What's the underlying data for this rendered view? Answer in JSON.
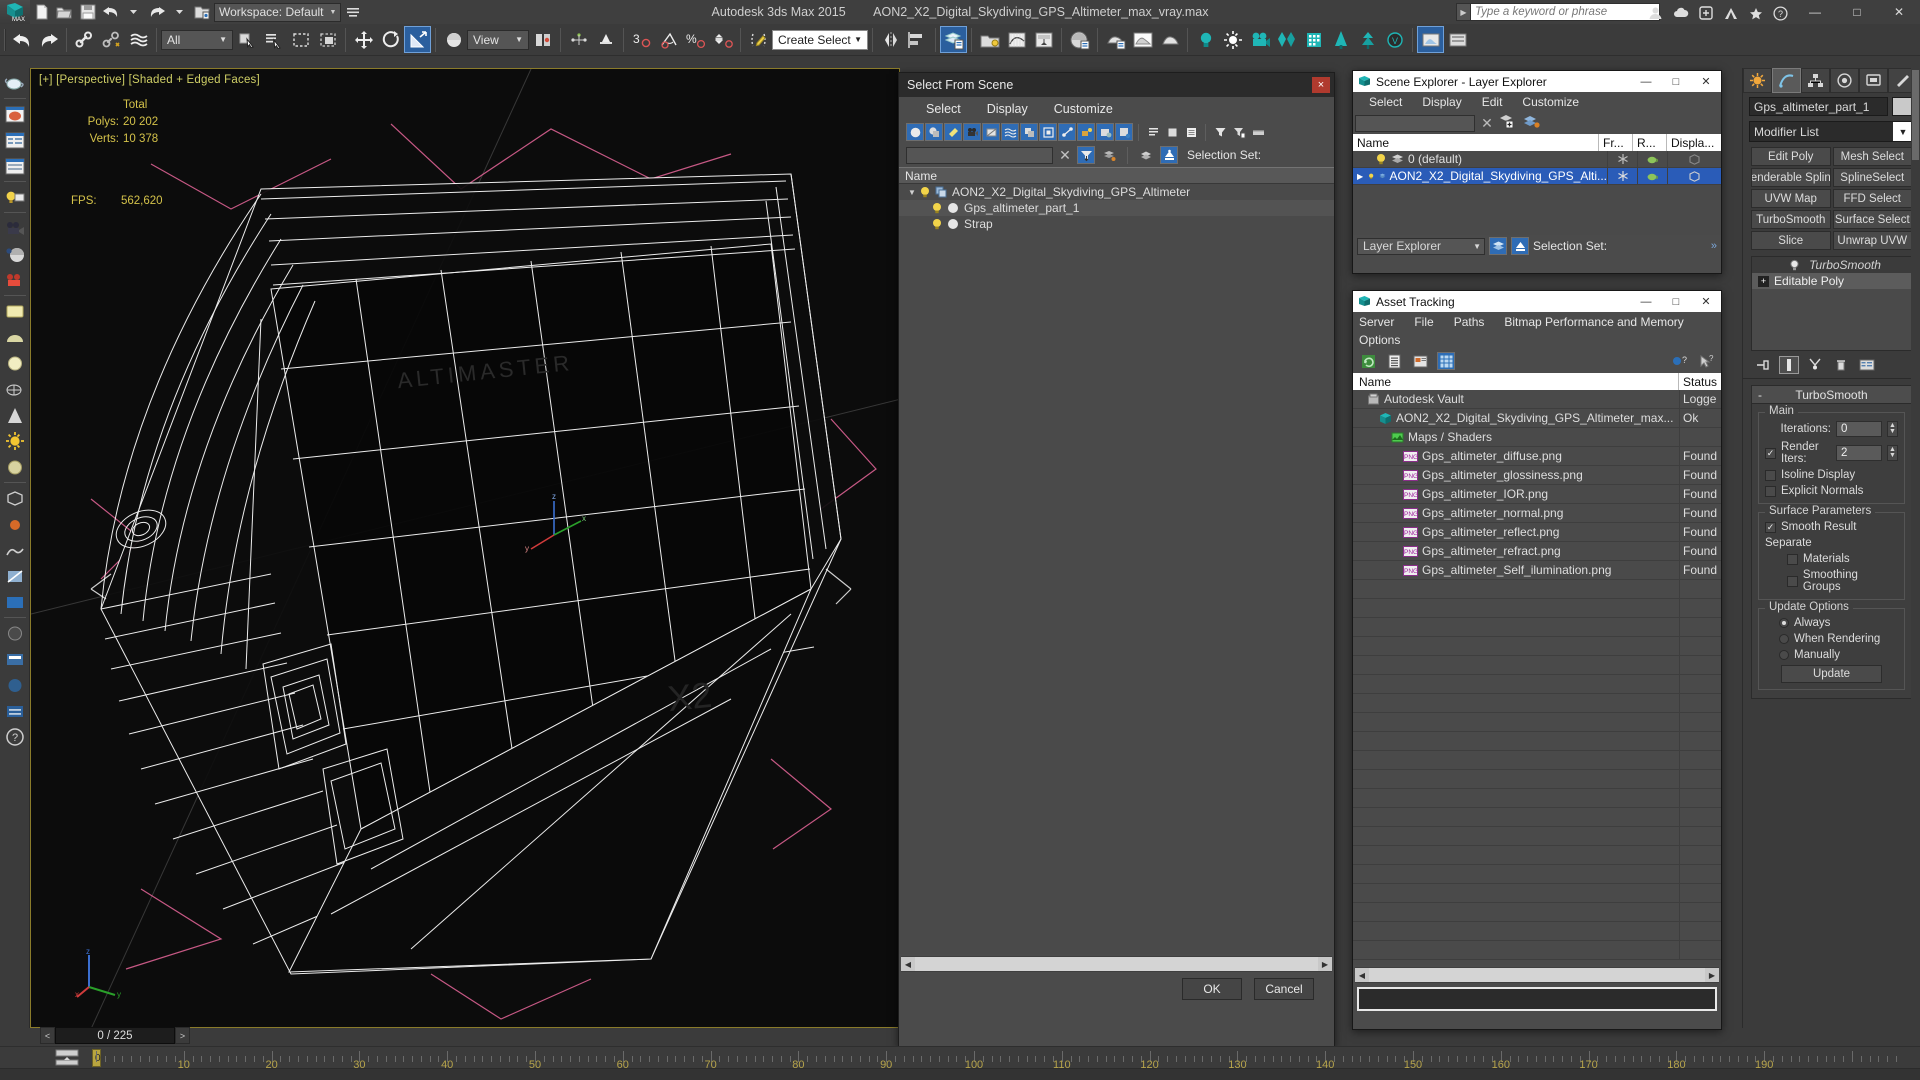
{
  "titlebar": {
    "logo": "max-logo",
    "workspace_label": "Workspace: Default",
    "app_name": "Autodesk 3ds Max  2015",
    "file_name": "AON2_X2_Digital_Skydiving_GPS_Altimeter_max_vray.max",
    "search_placeholder": "Type a keyword or phrase",
    "min_glyph": "—",
    "max_glyph": "□",
    "close_glyph": "✕"
  },
  "toolbar": {
    "selection_filter": "All",
    "ref_coord": "View",
    "named_selection_set": "Create Selection Se"
  },
  "viewport": {
    "label": "[+] [Perspective] [Shaded + Edged Faces]",
    "stats_header": "Total",
    "polys_label": "Polys:",
    "polys_value": "20 202",
    "verts_label": "Verts:",
    "verts_value": "10 378",
    "fps_label": "FPS:",
    "fps_value": "562,620",
    "axis_x": "x",
    "axis_y": "y",
    "axis_z": "z"
  },
  "select_from_scene": {
    "title": "Select From Scene",
    "menu": [
      "Select",
      "Display",
      "Customize"
    ],
    "filter_value": "",
    "selection_set_label": "Selection Set:",
    "column_name": "Name",
    "tree": [
      {
        "label": "AON2_X2_Digital_Skydiving_GPS_Altimeter",
        "depth": 0,
        "expanded": true
      },
      {
        "label": "Gps_altimeter_part_1",
        "depth": 1,
        "expanded": false
      },
      {
        "label": "Strap",
        "depth": 1,
        "expanded": false
      }
    ],
    "ok_label": "OK",
    "cancel_label": "Cancel",
    "close_glyph": "×"
  },
  "scene_explorer": {
    "title": "Scene Explorer - Layer Explorer",
    "menu": [
      "Select",
      "Display",
      "Edit",
      "Customize"
    ],
    "filter_value": "",
    "columns": [
      "Name",
      "Fr...",
      "R...",
      "Displa..."
    ],
    "rows": [
      {
        "name": "0 (default)",
        "selected": false
      },
      {
        "name": "AON2_X2_Digital_Skydiving_GPS_Alti...",
        "selected": true
      }
    ],
    "mode_value": "Layer Explorer",
    "selection_set_label": "Selection Set:",
    "min_glyph": "—",
    "max_glyph": "□",
    "close_glyph": "✕"
  },
  "asset_tracking": {
    "title": "Asset Tracking",
    "menu": [
      "Server",
      "File",
      "Paths",
      "Bitmap Performance and Memory",
      "Options"
    ],
    "columns": [
      "Name",
      "Status"
    ],
    "rows": [
      {
        "name": "Autodesk Vault",
        "status": "Logge",
        "icon": "vault-icon",
        "indent": 14
      },
      {
        "name": "AON2_X2_Digital_Skydiving_GPS_Altimeter_max...",
        "status": "Ok",
        "icon": "max-file-icon",
        "indent": 26
      },
      {
        "name": "Maps / Shaders",
        "status": "",
        "icon": "maps-icon",
        "indent": 38
      },
      {
        "name": "Gps_altimeter_diffuse.png",
        "status": "Found",
        "icon": "png-icon",
        "indent": 50
      },
      {
        "name": "Gps_altimeter_glossiness.png",
        "status": "Found",
        "icon": "png-icon",
        "indent": 50
      },
      {
        "name": "Gps_altimeter_IOR.png",
        "status": "Found",
        "icon": "png-icon",
        "indent": 50
      },
      {
        "name": "Gps_altimeter_normal.png",
        "status": "Found",
        "icon": "png-icon",
        "indent": 50
      },
      {
        "name": "Gps_altimeter_reflect.png",
        "status": "Found",
        "icon": "png-icon",
        "indent": 50
      },
      {
        "name": "Gps_altimeter_refract.png",
        "status": "Found",
        "icon": "png-icon",
        "indent": 50
      },
      {
        "name": "Gps_altimeter_Self_ilumination.png",
        "status": "Found",
        "icon": "png-icon",
        "indent": 50
      }
    ],
    "min_glyph": "—",
    "max_glyph": "□",
    "close_glyph": "✕"
  },
  "command_panel": {
    "object_name": "Gps_altimeter_part_1",
    "modifier_list_label": "Modifier List",
    "modifier_buttons": [
      "Edit Poly",
      "Mesh Select",
      "enderable Splin",
      "SplineSelect",
      "UVW Map",
      "FFD Select",
      "TurboSmooth",
      "Surface Select",
      "Slice",
      "Unwrap UVW"
    ],
    "stack": [
      {
        "label": "TurboSmooth",
        "selected": false,
        "italic": true
      },
      {
        "label": "Editable Poly",
        "selected": true,
        "italic": false
      }
    ],
    "rollup": {
      "title": "TurboSmooth",
      "collapse_glyph": "-",
      "main_group": "Main",
      "iterations_label": "Iterations:",
      "iterations_value": "0",
      "render_iters_label": "Render Iters:",
      "render_iters_value": "2",
      "render_iters_checked": true,
      "isoline_label": "Isoline Display",
      "isoline_checked": false,
      "explicit_label": "Explicit Normals",
      "explicit_checked": false,
      "surface_group": "Surface Parameters",
      "smooth_result_label": "Smooth Result",
      "smooth_result_checked": true,
      "separate_label": "Separate",
      "materials_label": "Materials",
      "materials_checked": false,
      "smoothing_groups_label": "Smoothing Groups",
      "smoothing_groups_checked": false,
      "update_group": "Update Options",
      "update_options": [
        {
          "label": "Always",
          "selected": true
        },
        {
          "label": "When Rendering",
          "selected": false
        },
        {
          "label": "Manually",
          "selected": false
        }
      ],
      "update_button": "Update"
    }
  },
  "timeline": {
    "prev_glyph": "<",
    "next_glyph": ">",
    "frame_display": "0 / 225",
    "current_frame": "0",
    "tick_labels": [
      "10",
      "20",
      "30",
      "40",
      "50",
      "60",
      "70",
      "80",
      "90",
      "100",
      "110",
      "120",
      "130",
      "140",
      "150",
      "160",
      "170",
      "180",
      "190"
    ]
  },
  "colors": {
    "accent_blue": "#2f6cb5",
    "select_blue": "#2a5cb8",
    "yellow_stats": "#d4c24a",
    "viewport_border": "#8a7b2a",
    "panel_bg": "#3b3b3b"
  }
}
